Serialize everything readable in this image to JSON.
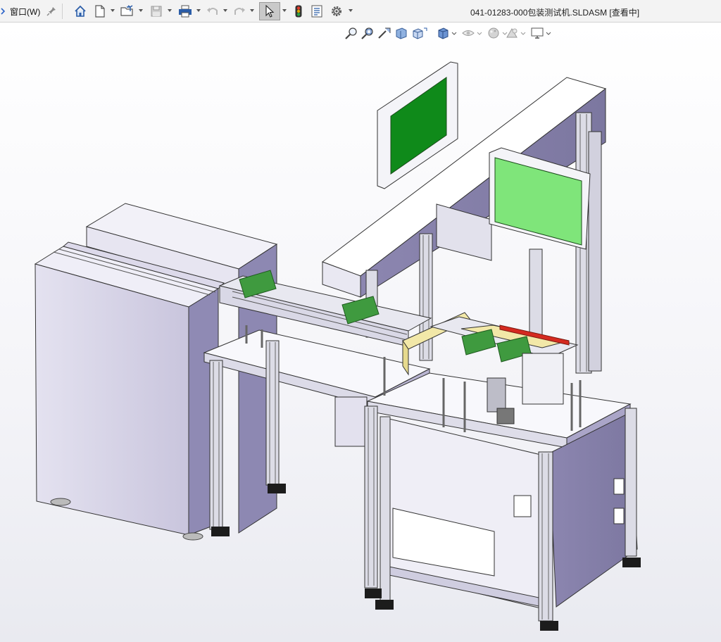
{
  "app": {
    "menu_window": "窗口(W)",
    "document_title": "041-01283-000包装测试机.SLDASM [查看中]"
  },
  "toolbar": {
    "icons": [
      "home-icon",
      "new-document-icon",
      "open-folder-icon",
      "save-icon",
      "print-icon",
      "undo-icon",
      "redo-icon",
      "select-pointer-icon",
      "rebuild-traffic-light-icon",
      "file-properties-icon",
      "options-gear-icon"
    ],
    "pin": "pin-icon"
  },
  "heads_up_view_toolbar": {
    "icons": [
      "zoom-to-fit-icon",
      "zoom-to-area-icon",
      "previous-view-icon",
      "section-view-icon",
      "view-orientation-icon",
      "display-style-icon",
      "hide-show-items-icon",
      "edit-appearance-icon",
      "apply-scene-icon",
      "view-settings-icon"
    ]
  },
  "model": {
    "name": "041-01283-000包装测试机",
    "colors": {
      "frame_lavender": "#d9d6ea",
      "frame_lavender_dark": "#8e89b3",
      "aluminum": "#dcdce6",
      "screen_green_dark": "#0f8a1a",
      "screen_green_light": "#7fe57a",
      "pcb_green": "#3f9a3f",
      "yellow_guard": "#f2e8a8",
      "red_strip": "#d52a20",
      "feet": "#1c1c1c"
    }
  }
}
